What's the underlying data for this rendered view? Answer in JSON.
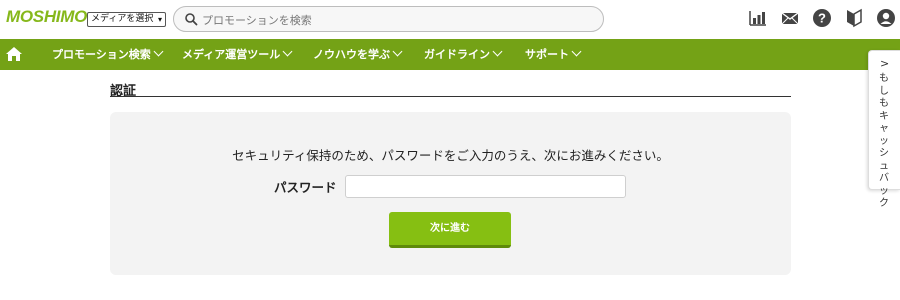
{
  "header": {
    "logo_text": "MOSHIMO",
    "media_select": {
      "selected": "メディアを選択"
    },
    "search": {
      "placeholder": "プロモーションを検索"
    },
    "icons": [
      "bar-chart-icon",
      "mail-icon",
      "help-icon",
      "beginner-mark-icon",
      "user-icon"
    ]
  },
  "nav": {
    "home_icon": "home-icon",
    "items": [
      {
        "label": "プロモーション検索"
      },
      {
        "label": "メディア運営ツール"
      },
      {
        "label": "ノウハウを学ぶ"
      },
      {
        "label": "ガイドライン"
      },
      {
        "label": "サポート"
      }
    ]
  },
  "side_tab": {
    "arrow": ">",
    "label": "もしもキャッシュバック"
  },
  "main": {
    "title": "認証",
    "message": "セキュリティ保持のため、パスワードをご入力のうえ、次にお進みください。",
    "password_label": "パスワード",
    "password_value": "",
    "next_button": "次に進む"
  },
  "colors": {
    "brand_green": "#74a216",
    "button_green": "#86bf12",
    "logo_green": "#86b81b",
    "panel_bg": "#f3f3f3"
  }
}
